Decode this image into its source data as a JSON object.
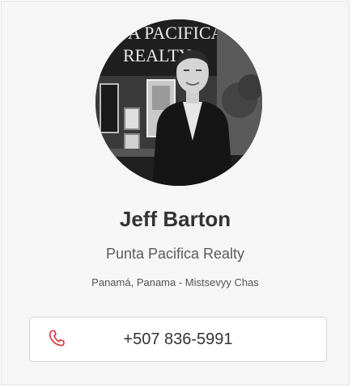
{
  "agent": {
    "name": "Jeff Barton",
    "company": "Punta Pacifica Realty",
    "location": "Panamá, Panama - Mistsevyy Chas",
    "phone": "+507 836-5991",
    "photo_sign_text_line1": "A PACIFICA",
    "photo_sign_text_line2": "REALTY"
  },
  "icons": {
    "phone": "phone-icon"
  },
  "colors": {
    "card_background": "#f6f6f6",
    "phone_icon": "#d9363e",
    "name_text": "#333333"
  }
}
